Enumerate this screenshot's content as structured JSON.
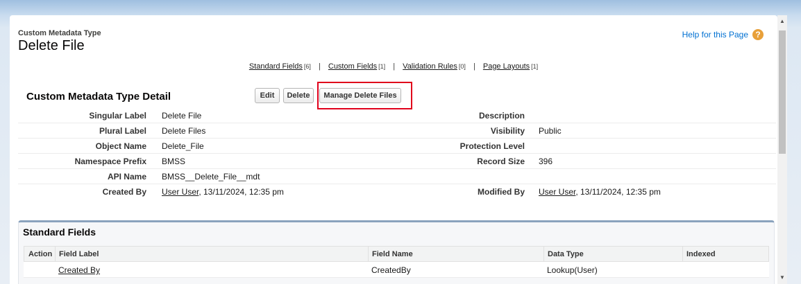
{
  "header": {
    "object_type": "Custom Metadata Type",
    "title": "Delete File",
    "help_link": "Help for this Page",
    "help_icon": "question-icon"
  },
  "related_links": [
    {
      "label": "Standard Fields",
      "count": "[6]"
    },
    {
      "label": "Custom Fields",
      "count": "[1]"
    },
    {
      "label": "Validation Rules",
      "count": "[0]"
    },
    {
      "label": "Page Layouts",
      "count": "[1]"
    }
  ],
  "detail": {
    "section_title": "Custom Metadata Type Detail",
    "buttons": {
      "edit": "Edit",
      "delete": "Delete",
      "manage": "Manage Delete Files"
    },
    "rows": [
      {
        "left_label": "Singular Label",
        "left_value": "Delete File",
        "right_label": "Description",
        "right_value": ""
      },
      {
        "left_label": "Plural Label",
        "left_value": "Delete Files",
        "right_label": "Visibility",
        "right_value": "Public"
      },
      {
        "left_label": "Object Name",
        "left_value": "Delete_File",
        "right_label": "Protection Level",
        "right_value": ""
      },
      {
        "left_label": "Namespace Prefix",
        "left_value": "BMSS",
        "right_label": "Record Size",
        "right_value": "396"
      },
      {
        "left_label": "API Name",
        "left_value": "BMSS__Delete_File__mdt",
        "right_label": "",
        "right_value": ""
      }
    ],
    "created": {
      "label": "Created By",
      "user": "User User",
      "date": ", 13/11/2024, 12:35 pm"
    },
    "modified": {
      "label": "Modified By",
      "user": "User User",
      "date": ", 13/11/2024, 12:35 pm"
    }
  },
  "standard_fields": {
    "title": "Standard Fields",
    "columns": [
      "Action",
      "Field Label",
      "Field Name",
      "Data Type",
      "Indexed"
    ],
    "rows": [
      {
        "action": "",
        "field_label": "Created By",
        "field_name": "CreatedBy",
        "data_type": "Lookup(User)",
        "indexed": ""
      }
    ]
  },
  "colors": {
    "highlight": "#e0001b",
    "link_blue": "#0070d2",
    "section_border": "#8aa2bd"
  }
}
